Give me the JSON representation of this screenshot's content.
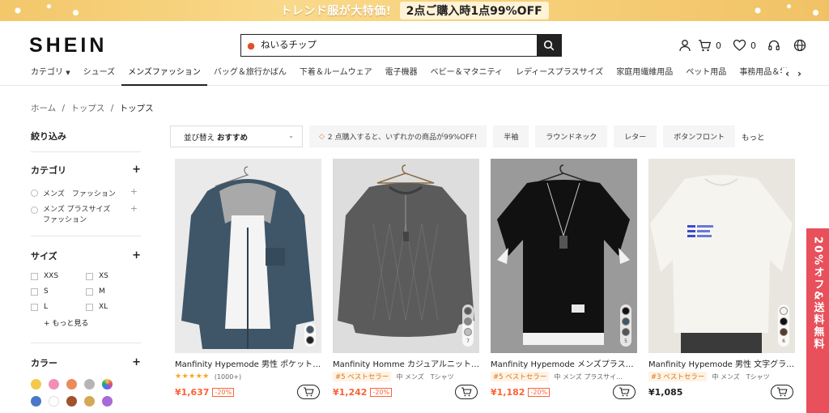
{
  "promo": {
    "text": "トレンド服が大特価!",
    "offer": "2点ご購入時1点99%OFF"
  },
  "header": {
    "logo": "SHEIN",
    "search_value": "ねいるチップ",
    "cart_count": "0",
    "wishlist_count": "0"
  },
  "nav": {
    "items": [
      "カテゴリ",
      "シューズ",
      "メンズファッション",
      "バッグ＆旅行かばん",
      "下着＆ルームウェア",
      "電子機器",
      "ベビー＆マタニティ",
      "レディースプラスサイズ",
      "家庭用繊維用品",
      "ペット用品",
      "事務用品＆学"
    ]
  },
  "breadcrumb": [
    "ホーム",
    "/",
    "トップス",
    "/",
    "トップス"
  ],
  "sidebar": {
    "title": "絞り込み",
    "category": {
      "heading": "カテゴリ",
      "items": [
        "メンズ　ファッション",
        "メンズ プラスサイズ ファッション"
      ]
    },
    "size": {
      "heading": "サイズ",
      "items": [
        "XXS",
        "XS",
        "S",
        "M",
        "L",
        "XL"
      ],
      "more": "もっと見る"
    },
    "color": {
      "heading": "カラー",
      "swatches": [
        "#f2c94c",
        "#f28fb6",
        "#eb8a5a",
        "#b5b5b5",
        "multi",
        "#4a77c9",
        "#ffffff",
        "#a0522d",
        "#d4a857",
        "#a86ad6"
      ]
    }
  },
  "filters": {
    "sort_label": "並び替え",
    "sort_value": "おすすめ",
    "promo": "2 点購入すると、いずれかの商品が99%OFF!",
    "chips": [
      "半袖",
      "ラウンドネック",
      "レター",
      "ボタンフロント"
    ],
    "more": "もっと"
  },
  "products": [
    {
      "title": "Manfinity Hypemode 男性 ポケット付きパッチ…",
      "rating": "(1000+)",
      "best": "",
      "tags": "",
      "price": "¥1,637",
      "discount": "-20%",
      "thumb_count": ""
    },
    {
      "title": "Manfinity Homme カジュアルニット…",
      "rating": "",
      "best": "#5 ベストセラー",
      "tags": "中 メンズ　Tシャツ",
      "price": "¥1,242",
      "discount": "-20%",
      "thumb_count": "7"
    },
    {
      "title": "Manfinity Hypemode メンズプラス…",
      "rating": "",
      "best": "#5 ベストセラー",
      "tags": "中 メンズ プラスサイ…",
      "price": "¥1,182",
      "discount": "-20%",
      "thumb_count": "5"
    },
    {
      "title": "Manfinity Hypemode 男性 文字グラ…",
      "rating": "",
      "best": "#3 ベストセラー",
      "tags": "中 メンズ　Tシャツ",
      "price": "¥1,085",
      "discount": "",
      "thumb_count": "6"
    }
  ],
  "side_badge": "20%オフ&送料無料"
}
